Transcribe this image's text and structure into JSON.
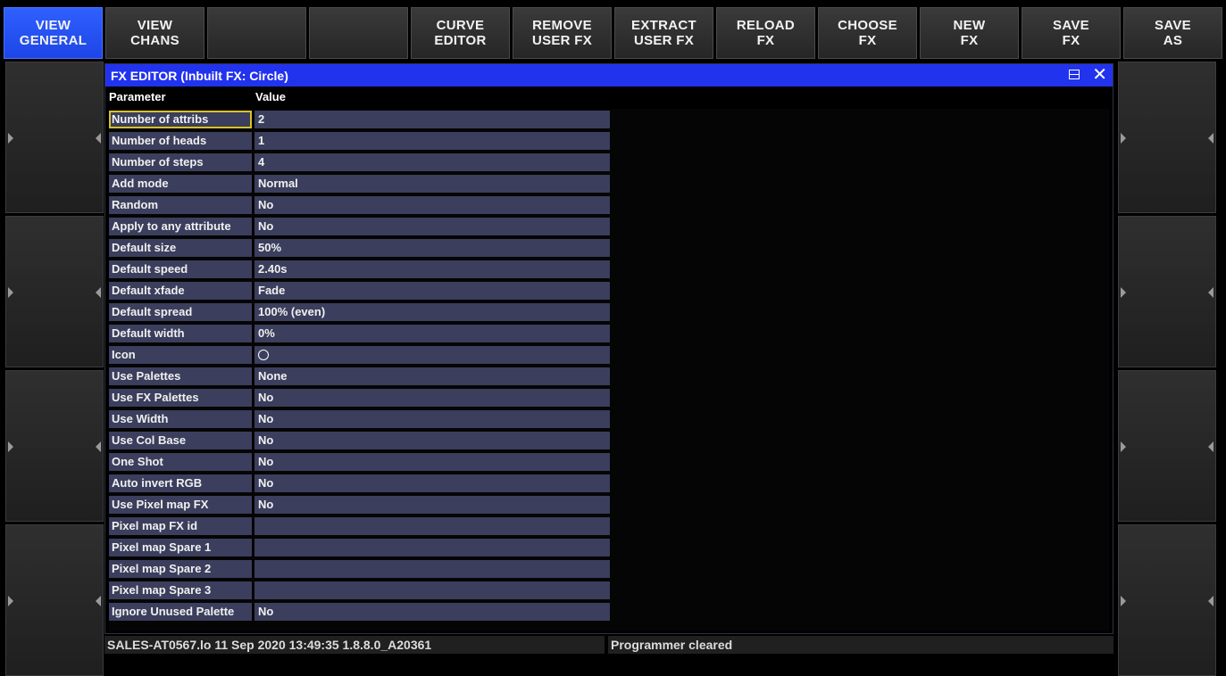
{
  "toolbar": {
    "buttons": [
      {
        "label": "VIEW\nGENERAL"
      },
      {
        "label": "VIEW\nCHANS"
      },
      {
        "label": ""
      },
      {
        "label": ""
      },
      {
        "label": "CURVE\nEDITOR"
      },
      {
        "label": "REMOVE\nUSER FX"
      },
      {
        "label": "EXTRACT\nUSER FX"
      },
      {
        "label": "RELOAD\nFX"
      },
      {
        "label": "CHOOSE\nFX"
      },
      {
        "label": "NEW\nFX"
      },
      {
        "label": "SAVE\nFX"
      },
      {
        "label": "SAVE\nAS"
      }
    ]
  },
  "editor": {
    "title": "FX EDITOR (Inbuilt FX: Circle)",
    "col_parameter": "Parameter",
    "col_value": "Value",
    "rows": [
      {
        "param": "Number of attribs",
        "value": "2"
      },
      {
        "param": "Number of heads",
        "value": "1"
      },
      {
        "param": "Number of steps",
        "value": "4"
      },
      {
        "param": "Add mode",
        "value": "Normal"
      },
      {
        "param": "Random",
        "value": "No"
      },
      {
        "param": "Apply to any attribute",
        "value": "No"
      },
      {
        "param": "Default size",
        "value": "50%"
      },
      {
        "param": "Default speed",
        "value": "2.40s"
      },
      {
        "param": "Default xfade",
        "value": "Fade"
      },
      {
        "param": "Default spread",
        "value": "100% (even)"
      },
      {
        "param": "Default width",
        "value": "0%"
      },
      {
        "param": "Icon",
        "value": ""
      },
      {
        "param": "Use Palettes",
        "value": "None"
      },
      {
        "param": "Use FX Palettes",
        "value": "No"
      },
      {
        "param": "Use Width",
        "value": "No"
      },
      {
        "param": "Use Col Base",
        "value": "No"
      },
      {
        "param": "One Shot",
        "value": "No"
      },
      {
        "param": "Auto invert RGB",
        "value": "No"
      },
      {
        "param": "Use Pixel map FX",
        "value": "No"
      },
      {
        "param": "Pixel map FX id",
        "value": ""
      },
      {
        "param": "Pixel map Spare 1",
        "value": ""
      },
      {
        "param": "Pixel map Spare 2",
        "value": ""
      },
      {
        "param": "Pixel map Spare 3",
        "value": ""
      },
      {
        "param": "Ignore Unused Palette",
        "value": "No"
      }
    ]
  },
  "status": {
    "left": "SALES-AT0567.lo 11 Sep 2020 13:49:35 1.8.8.0_A20361",
    "right": "Programmer cleared"
  },
  "colors": {
    "accent": "#2233ee",
    "active_button": "#2a55ff",
    "cell": "#3b3e5c",
    "selection": "#d8c224"
  }
}
